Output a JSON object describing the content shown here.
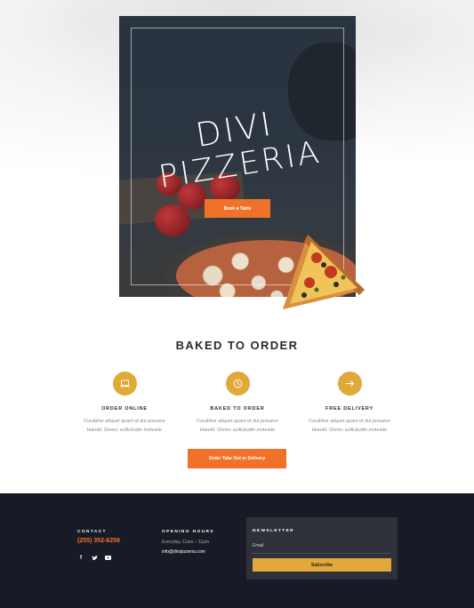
{
  "hero": {
    "title_line1": "DIVI",
    "title_line2": "PIZZERIA",
    "button_label": "Book a Table"
  },
  "features": {
    "heading": "BAKED TO ORDER",
    "items": [
      {
        "icon": "laptop-icon",
        "title": "ORDER ONLINE",
        "text_line1": "Curabitur aliquet quam id dui posuere",
        "text_line2": "blandit. Donec sollicitudin molestie"
      },
      {
        "icon": "clock-icon",
        "title": "BAKED TO ORDER",
        "text_line1": "Curabitur aliquet quam id dui posuere",
        "text_line2": "blandit. Donec sollicitudin molestie"
      },
      {
        "icon": "arrow-right-icon",
        "title": "FREE DELIVERY",
        "text_line1": "Curabitur aliquet quam id dui posuere",
        "text_line2": "blandit. Donec sollicitudin molestie"
      }
    ],
    "cta_label": "Order Take Out or Delivery"
  },
  "footer": {
    "contact_label": "CONTACT",
    "phone": "(255) 352-6258",
    "social": [
      "f",
      "t",
      "yt"
    ],
    "hours_label": "OPENING HOURS",
    "hours_text": "Everyday, 11am – 11pm",
    "email": "info@divipizzeria.com",
    "newsletter": {
      "label": "NEWSLETTER",
      "email_placeholder": "Email",
      "subscribe_label": "Subscribe"
    }
  },
  "colors": {
    "accent_orange": "#f0722a",
    "accent_gold": "#e0a93a",
    "footer_bg": "#181b25",
    "newsletter_bg": "#2e3139"
  }
}
